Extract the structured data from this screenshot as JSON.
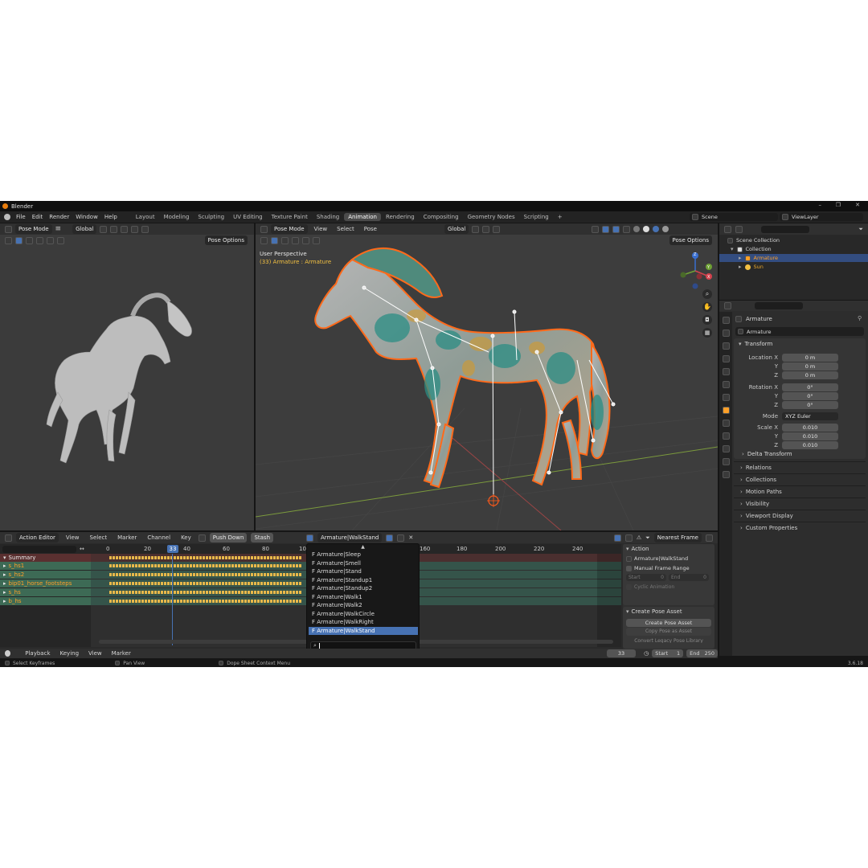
{
  "app": {
    "title": "Blender",
    "version": "3.6.18"
  },
  "menubar": {
    "menus": [
      "File",
      "Edit",
      "Render",
      "Window",
      "Help"
    ],
    "workspaces": [
      "Layout",
      "Modeling",
      "Sculpting",
      "UV Editing",
      "Texture Paint",
      "Shading",
      "Animation",
      "Rendering",
      "Compositing",
      "Geometry Nodes",
      "Scripting"
    ],
    "active_workspace": "Animation",
    "add_tab": "+",
    "scene": "Scene",
    "view_layer": "ViewLayer"
  },
  "left_viewport": {
    "mode": "Pose Mode",
    "orientation": "Global",
    "pose_options": "Pose Options"
  },
  "main_viewport": {
    "mode": "Pose Mode",
    "menus": [
      "View",
      "Select",
      "Pose"
    ],
    "orientation": "Global",
    "pose_options": "Pose Options",
    "overlay_title": "User Perspective",
    "overlay_subtitle": "(33) Armature : Armature",
    "gizmo_axes": [
      "X",
      "Y",
      "Z"
    ]
  },
  "outliner": {
    "items": [
      {
        "label": "Scene Collection",
        "indent": 0
      },
      {
        "label": "Collection",
        "indent": 1
      },
      {
        "label": "Armature",
        "indent": 2,
        "selected": true
      },
      {
        "label": "Sun",
        "indent": 2
      }
    ]
  },
  "properties": {
    "object_name": "Armature",
    "data_name": "Armature",
    "transform_title": "Transform",
    "location": {
      "label": "Location X",
      "x": "0 m",
      "y": "0 m",
      "z": "0 m"
    },
    "rotation": {
      "label": "Rotation X",
      "x": "0°",
      "y": "0°",
      "z": "0°"
    },
    "mode_label": "Mode",
    "mode_value": "XYZ Euler",
    "scale": {
      "label": "Scale X",
      "x": "0.010",
      "y": "0.010",
      "z": "0.010"
    },
    "axis_y": "Y",
    "axis_z": "Z",
    "sections": [
      "Delta Transform",
      "Relations",
      "Collections",
      "Motion Paths",
      "Visibility",
      "Viewport Display",
      "Custom Properties"
    ]
  },
  "action_editor": {
    "editor_mode": "Action Editor",
    "menus": [
      "View",
      "Select",
      "Marker",
      "Channel",
      "Key"
    ],
    "push_down": "Push Down",
    "stash": "Stash",
    "action_name": "Armature|WalkStand",
    "snapping": "Nearest Frame",
    "current_frame": "33",
    "ruler_ticks": [
      "0",
      "20",
      "40",
      "60",
      "80",
      "100",
      "160",
      "180",
      "200",
      "220",
      "240"
    ],
    "channels": [
      "Summary",
      "s_hs1",
      "s_hs2",
      "bip01_horse_footsteps",
      "s_hs",
      "b_hs"
    ],
    "dropdown_items": [
      "Armature|Sleep",
      "Armature|Smell",
      "Armature|Stand",
      "Armature|Standup1",
      "Armature|Standup2",
      "Armature|Walk1",
      "Armature|Walk2",
      "Armature|WalkCircle",
      "Armature|WalkRight",
      "Armature|WalkStand"
    ],
    "dropdown_selected": "Armature|WalkStand",
    "dropdown_prefix": "F"
  },
  "sidebar": {
    "action_panel": "Action",
    "action_value": "Armature|WalkStand",
    "manual_frame_range": "Manual Frame Range",
    "start_label": "Start",
    "start_value": "0",
    "end_label": "End",
    "end_value": "0",
    "cyclic": "Cyclic Animation",
    "create_pose_panel": "Create Pose Asset",
    "create_pose_button": "Create Pose Asset",
    "copy_pose_button": "Copy Pose as Asset",
    "convert_library": "Convert Legacy Pose Library"
  },
  "timeline": {
    "menus": [
      "Playback",
      "Keying",
      "View",
      "Marker"
    ],
    "current_frame": "33",
    "start_label": "Start",
    "start_value": "1",
    "end_label": "End",
    "end_value": "250"
  },
  "statusbar": {
    "select_keyframes": "Select Keyframes",
    "pan_view": "Pan View",
    "context_menu": "Dope Sheet Context Menu"
  },
  "colors": {
    "accent": "#4772b3",
    "active_object": "#ffa028",
    "keyframe": "#e8b84a",
    "channel_row": "#3d6a55"
  }
}
